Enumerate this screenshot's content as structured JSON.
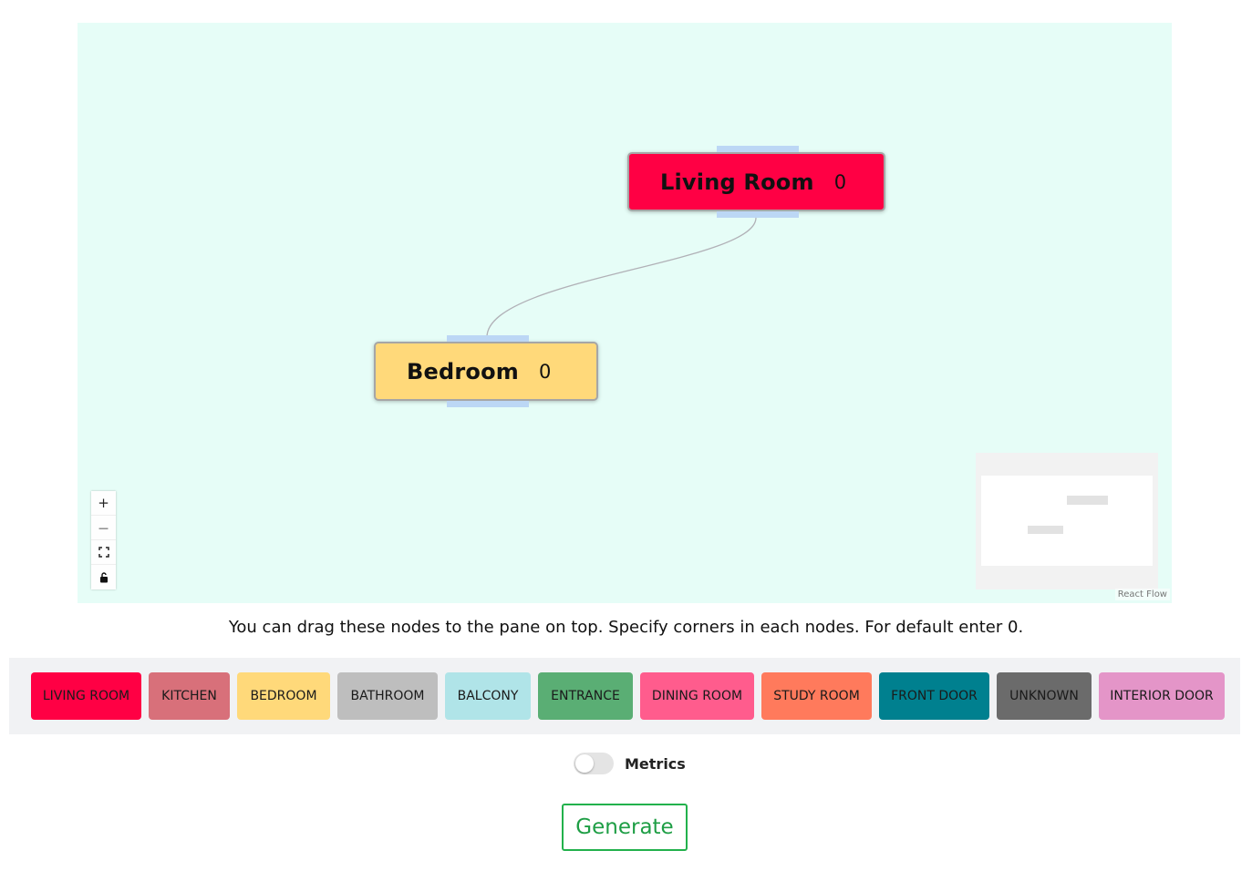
{
  "flow": {
    "nodes": [
      {
        "id": "living-room",
        "label": "Living Room",
        "count": "0",
        "color": "#ff0044"
      },
      {
        "id": "bedroom",
        "label": "Bedroom",
        "count": "0",
        "color": "#ffd97a"
      }
    ],
    "controls": {
      "zoom_in": "+",
      "zoom_out": "—",
      "fit_view": "⛶",
      "lock": "🔓"
    },
    "attribution": "React Flow"
  },
  "instructions": "You can drag these nodes to the pane on top. Specify corners in each nodes. For default enter 0.",
  "palette": [
    {
      "label": "LIVING ROOM",
      "color": "#ff0044"
    },
    {
      "label": "KITCHEN",
      "color": "#d8707a"
    },
    {
      "label": "BEDROOM",
      "color": "#ffd97a"
    },
    {
      "label": "BATHROOM",
      "color": "#bebebe"
    },
    {
      "label": "BALCONY",
      "color": "#b0e4e8"
    },
    {
      "label": "ENTRANCE",
      "color": "#5aae74"
    },
    {
      "label": "DINING ROOM",
      "color": "#ff5c8d"
    },
    {
      "label": "STUDY ROOM",
      "color": "#ff7a5c"
    },
    {
      "label": "FRONT DOOR",
      "color": "#00808f"
    },
    {
      "label": "UNKNOWN",
      "color": "#6b6b6b"
    },
    {
      "label": "INTERIOR DOOR",
      "color": "#e495c8"
    }
  ],
  "metrics": {
    "label": "Metrics",
    "enabled": false
  },
  "generate": {
    "label": "Generate"
  }
}
